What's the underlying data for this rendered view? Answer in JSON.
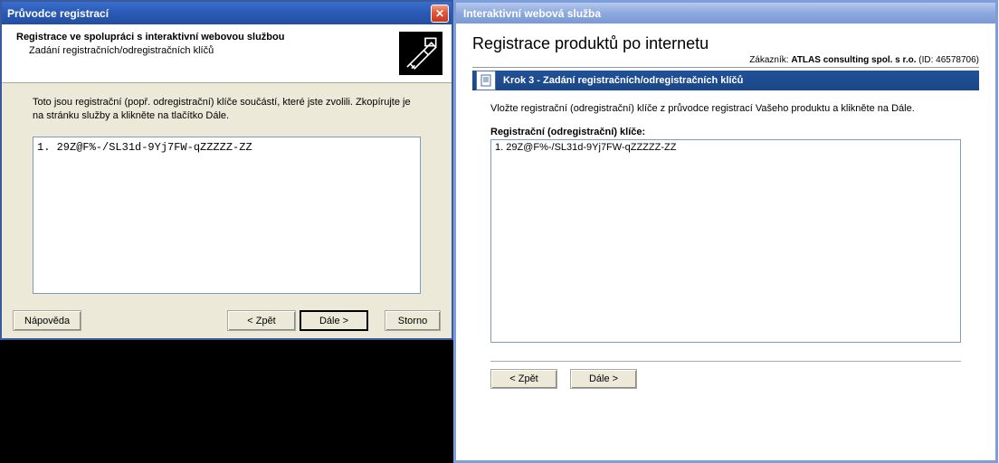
{
  "left": {
    "title": "Průvodce registrací",
    "header_title": "Registrace ve spolupráci s interaktivní webovou službou",
    "header_sub": "Zadání registračních/odregistračních klíčů",
    "instruction": "Toto jsou registrační (popř. odregistrační) klíče součástí, které jste zvolili. Zkopírujte je na stránku služby a klikněte na tlačítko Dále.",
    "textarea_value": "1. 29Z@F%-/SL31d-9Yj7FW-qZZZZZ-ZZ",
    "buttons": {
      "help": "Nápověda",
      "back": "< Zpět",
      "next": "Dále >",
      "cancel": "Storno"
    }
  },
  "right": {
    "title": "Interaktivní webová služba",
    "page_title": "Registrace produktů po internetu",
    "customer_label": "Zákazník:",
    "customer_name": "ATLAS consulting spol. s r.o.",
    "customer_id": "(ID: 46578706)",
    "step_label": "Krok 3 - Zadání registračních/odregistračních klíčů",
    "instruction": "Vložte registrační (odregistrační) klíče z průvodce registrací Vašeho produktu a klikněte na Dále.",
    "keys_label": "Registrační (odregistrační) klíče:",
    "textarea_value": "1. 29Z@F%-/SL31d-9Yj7FW-qZZZZZ-ZZ",
    "buttons": {
      "back": "< Zpět",
      "next": "Dále >"
    }
  }
}
